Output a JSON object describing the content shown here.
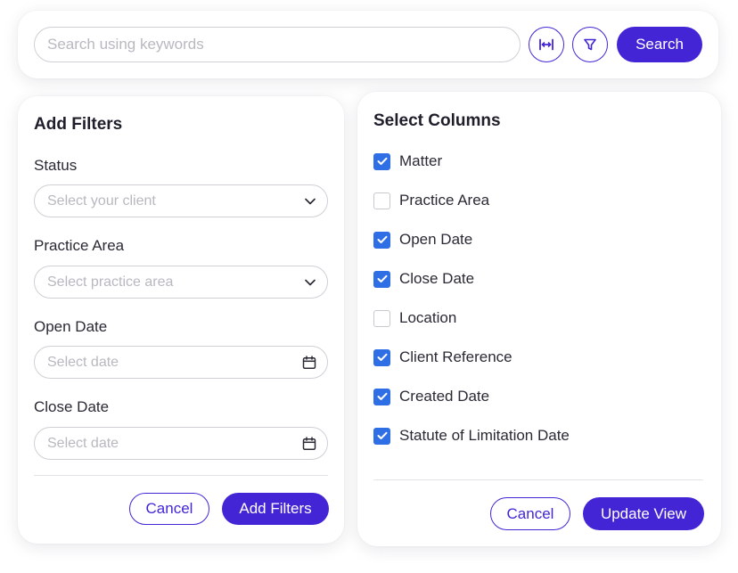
{
  "search": {
    "placeholder": "Search using keywords",
    "value": "",
    "width_icon": "column-width-icon",
    "filter_icon": "funnel-icon",
    "button_label": "Search"
  },
  "filters": {
    "title": "Add Filters",
    "fields": [
      {
        "label": "Status",
        "placeholder": "Select your client",
        "icon": "chevron-down-icon"
      },
      {
        "label": "Practice Area",
        "placeholder": "Select practice area",
        "icon": "chevron-down-icon"
      },
      {
        "label": "Open Date",
        "placeholder": "Select date",
        "icon": "calendar-icon"
      },
      {
        "label": "Close Date",
        "placeholder": "Select date",
        "icon": "calendar-icon"
      }
    ],
    "cancel_label": "Cancel",
    "submit_label": "Add Filters"
  },
  "columns": {
    "title": "Select Columns",
    "items": [
      {
        "label": "Matter",
        "checked": true
      },
      {
        "label": "Practice Area",
        "checked": false
      },
      {
        "label": "Open Date",
        "checked": true
      },
      {
        "label": "Close Date",
        "checked": true
      },
      {
        "label": "Location",
        "checked": false
      },
      {
        "label": "Client Reference",
        "checked": true
      },
      {
        "label": "Created Date",
        "checked": true
      },
      {
        "label": "Statute of Limitation Date",
        "checked": true
      }
    ],
    "cancel_label": "Cancel",
    "submit_label": "Update View"
  },
  "colors": {
    "accent": "#4325d6",
    "checkbox": "#2f6fe6",
    "border": "#cfcfd6",
    "placeholder": "#b8b8c0"
  }
}
